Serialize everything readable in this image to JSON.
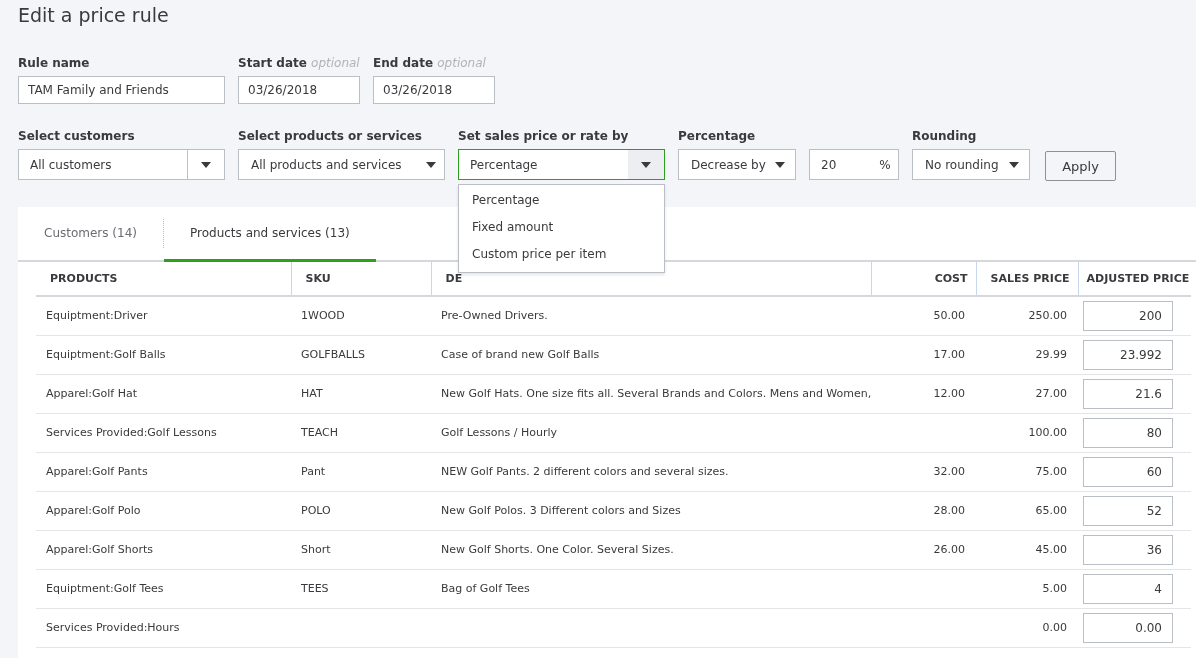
{
  "title": "Edit a price rule",
  "top_fields": [
    {
      "label": "Rule name",
      "value": "TAM Family and Friends",
      "kind": "wide"
    },
    {
      "label": "Start date",
      "hint": "optional",
      "value": "03/26/2018",
      "kind": "date"
    },
    {
      "label": "End date",
      "hint": "optional",
      "value": "03/26/2018",
      "kind": "date"
    }
  ],
  "selects": [
    {
      "label": "Select customers",
      "value": "All customers",
      "kind": "split",
      "open": false
    },
    {
      "label": "Select products or services",
      "value": "All products and services",
      "kind": "plain",
      "open": false
    },
    {
      "label": "Set sales price or rate by",
      "value": "Percentage",
      "kind": "split",
      "open": true,
      "options": [
        "Percentage",
        "Fixed amount",
        "Custom price per item"
      ]
    },
    {
      "label": "Percentage",
      "value": "Decrease by",
      "kind": "small",
      "open": false
    },
    {
      "value": "20",
      "kind": "amount",
      "suffix": "%",
      "open": false
    },
    {
      "label": "Rounding",
      "value": "No rounding",
      "kind": "small",
      "open": false
    }
  ],
  "apply_button": "Apply",
  "tabs": [
    {
      "label": "Customers (14)",
      "selected": false
    },
    {
      "label": "Products and services (13)",
      "selected": true
    }
  ],
  "table": {
    "columns": [
      "PRODUCTS",
      "SKU",
      "DE",
      "COST",
      "SALES PRICE",
      "ADJUSTED PRICE"
    ],
    "rows": [
      [
        "Equiptment:Driver",
        "1WOOD",
        "Pre-Owned Drivers.",
        "50.00",
        "250.00",
        "200"
      ],
      [
        "Equiptment:Golf Balls",
        "GOLFBALLS",
        "Case of brand new Golf Balls",
        "17.00",
        "29.99",
        "23.992"
      ],
      [
        "Apparel:Golf Hat",
        "HAT",
        "New Golf Hats. One size fits all. Several Brands and Colors. Mens and Women,",
        "12.00",
        "27.00",
        "21.6"
      ],
      [
        "Services Provided:Golf Lessons",
        "TEACH",
        "Golf Lessons / Hourly",
        "",
        "100.00",
        "80"
      ],
      [
        "Apparel:Golf Pants",
        "Pant",
        "NEW Golf Pants. 2 different colors and several sizes.",
        "32.00",
        "75.00",
        "60"
      ],
      [
        "Apparel:Golf Polo",
        "POLO",
        "New Golf Polos. 3 Different colors and Sizes",
        "28.00",
        "65.00",
        "52"
      ],
      [
        "Apparel:Golf Shorts",
        "Short",
        "New Golf Shorts. One Color. Several Sizes.",
        "26.00",
        "45.00",
        "36"
      ],
      [
        "Equiptment:Golf Tees",
        "TEES",
        "Bag of Golf Tees",
        "",
        "5.00",
        "4"
      ],
      [
        "Services Provided:Hours",
        "",
        "",
        "",
        "0.00",
        "0.00"
      ]
    ]
  }
}
